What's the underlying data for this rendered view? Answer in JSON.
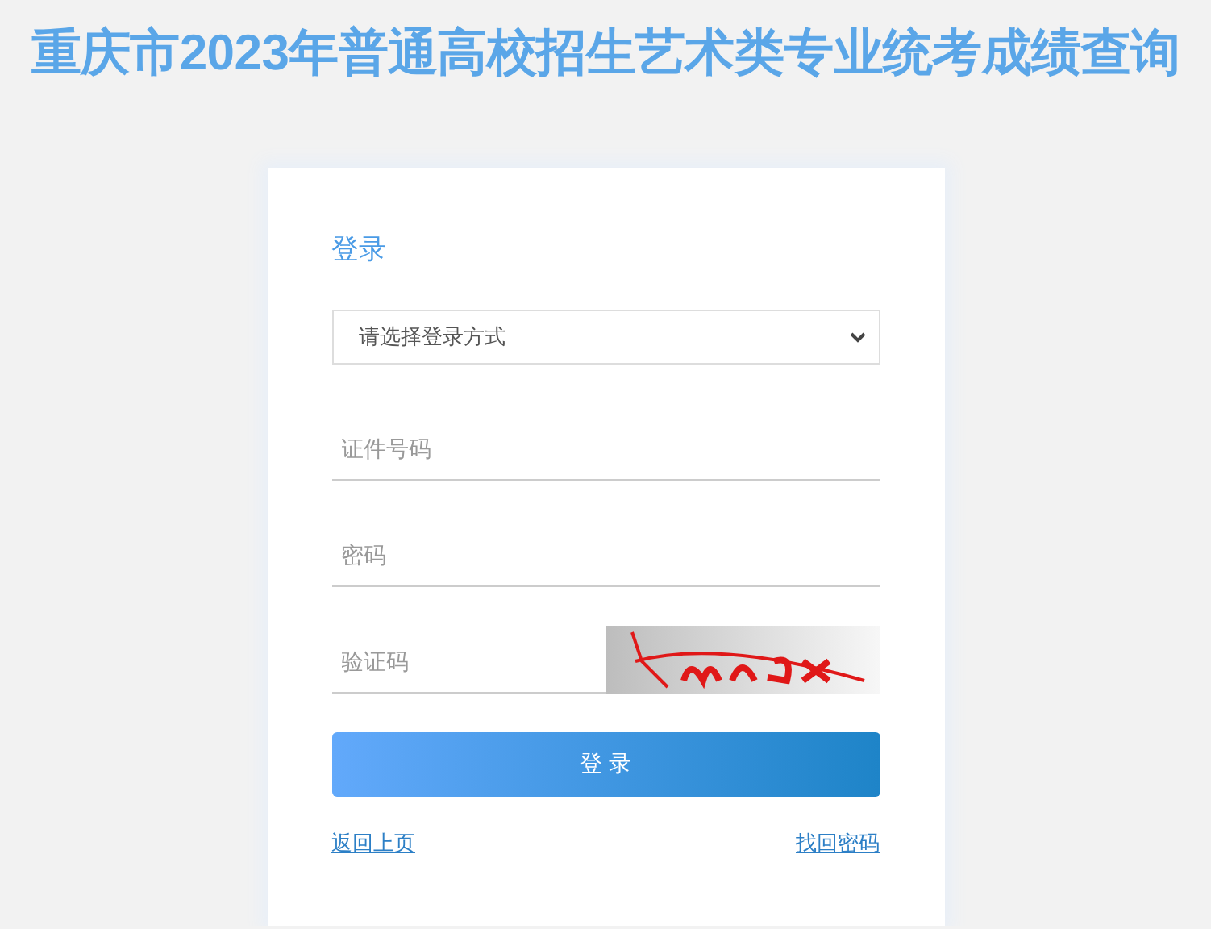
{
  "title": "重庆市2023年普通高校招生艺术类专业统考成绩查询",
  "login": {
    "heading": "登录",
    "method_select": {
      "value": "请选择登录方式"
    },
    "fields": [
      {
        "kind": "text",
        "placeholder": "证件号码"
      },
      {
        "kind": "password",
        "placeholder": "密码"
      },
      {
        "kind": "captcha",
        "placeholder": "验证码"
      }
    ],
    "submit_button": "登 录",
    "links": [
      "返回上页",
      "找回密码"
    ]
  }
}
